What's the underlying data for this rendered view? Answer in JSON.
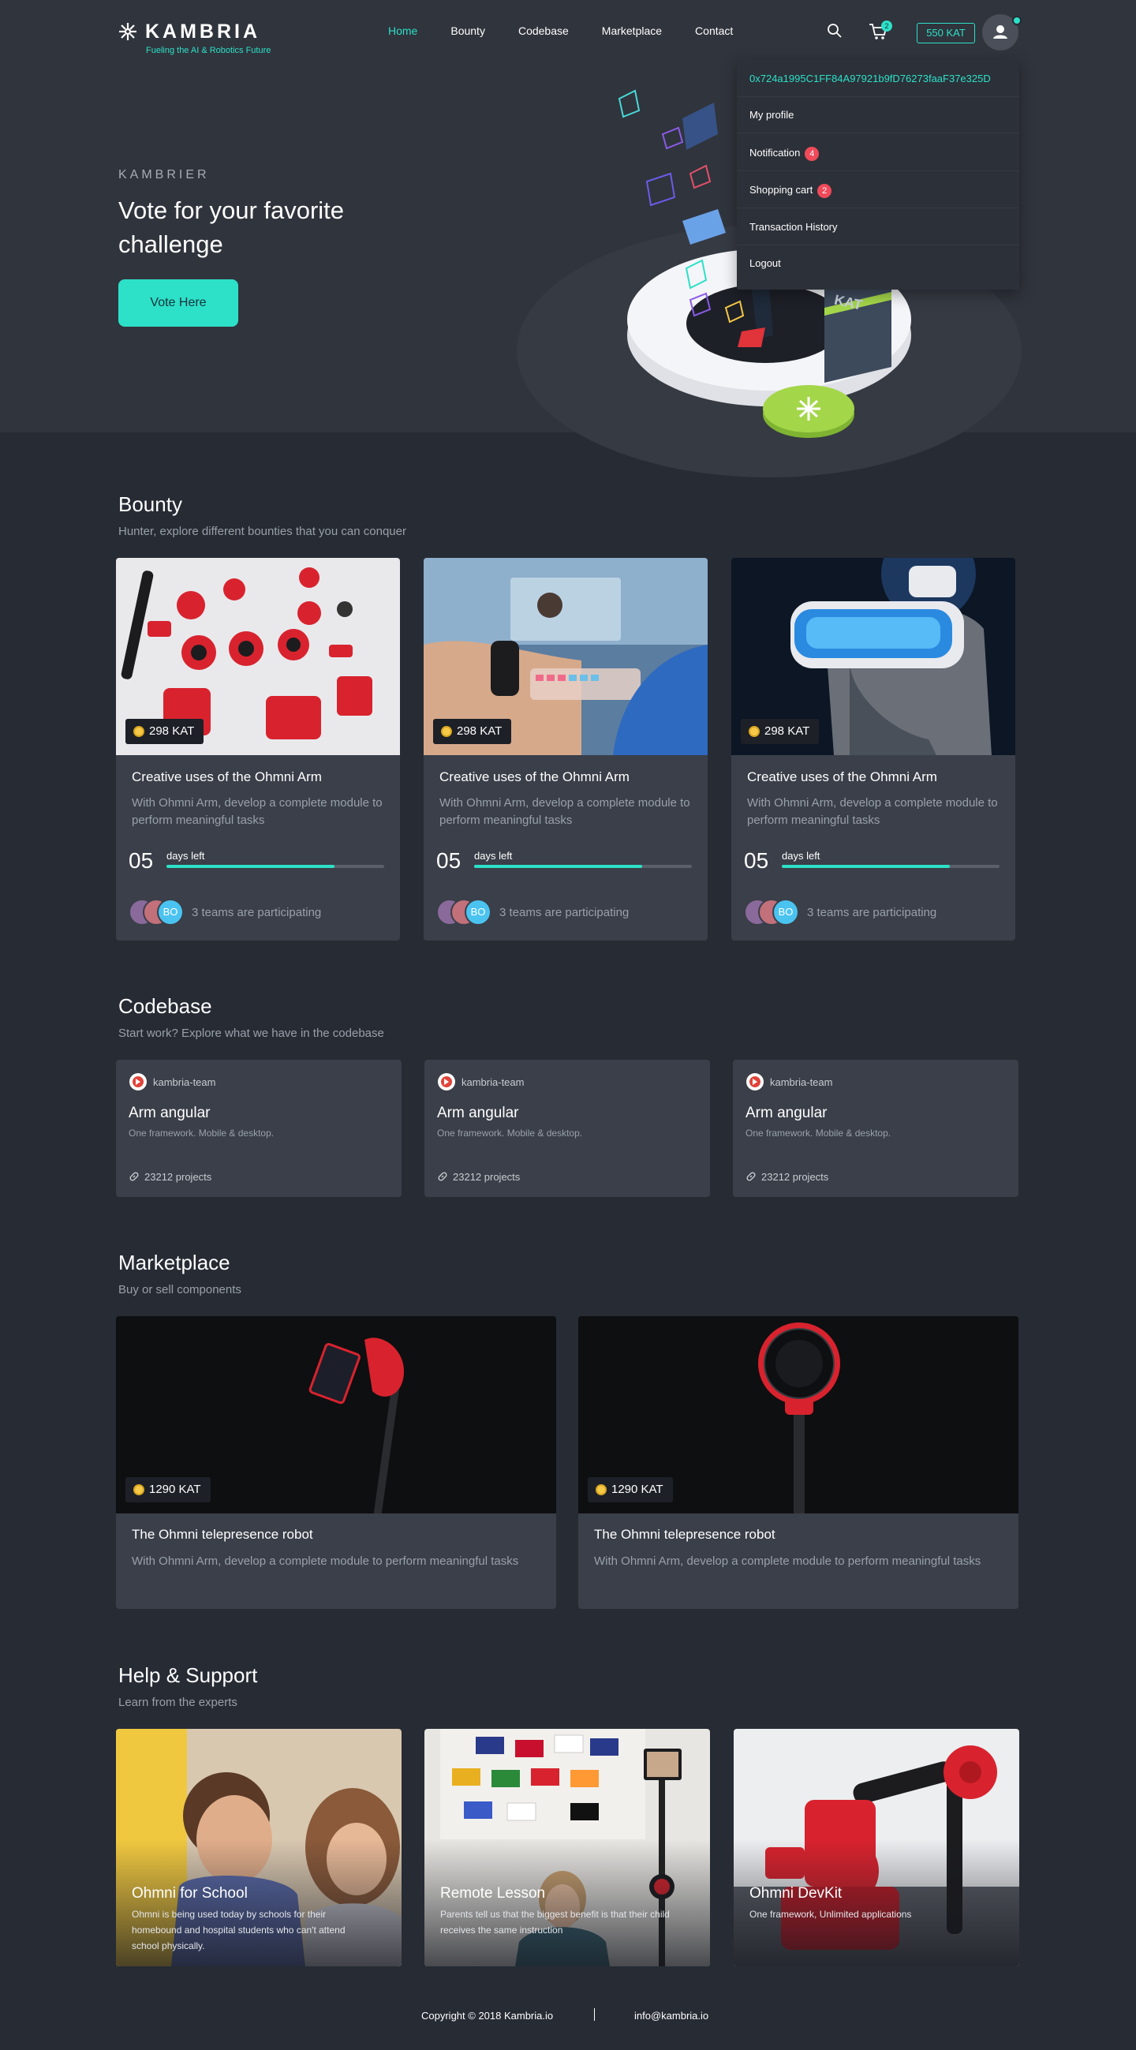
{
  "brand": {
    "name": "KAMBRIA",
    "tagline": "Fueling the AI & Robotics Future"
  },
  "nav": {
    "items": [
      {
        "label": "Home",
        "active": true
      },
      {
        "label": "Bounty",
        "active": false
      },
      {
        "label": "Codebase",
        "active": false
      },
      {
        "label": "Marketplace",
        "active": false
      },
      {
        "label": "Contact",
        "active": false
      }
    ]
  },
  "header": {
    "search_icon": "search-icon",
    "cart_icon": "cart-icon",
    "cart_count": "2",
    "balance": "550 KAT",
    "avatar_icon": "user-icon"
  },
  "hero": {
    "eyebrow": "KAMBRIER",
    "title": "Vote for your favorite challenge",
    "button": "Vote Here",
    "illustration_text": "KAT"
  },
  "dropdown": {
    "wallet": "0x724a1995C1FF84A97921b9fD76273faaF37e325D",
    "items": [
      {
        "label": "My profile",
        "badge": ""
      },
      {
        "label": "Notification",
        "badge": "4"
      },
      {
        "label": "Shopping cart",
        "badge": "2"
      },
      {
        "label": "Transaction History",
        "badge": ""
      },
      {
        "label": "Logout",
        "badge": ""
      }
    ]
  },
  "bounty": {
    "title": "Bounty",
    "subtitle": "Hunter, explore different bounties that you can conquer",
    "cards": [
      {
        "reward": "298 KAT",
        "title": "Creative uses of the Ohmni Arm",
        "desc": "With Ohmni Arm, develop a complete module to perform meaningful tasks",
        "days": "05",
        "days_label": "days left",
        "progress": 0.77,
        "avatar_initials": "BO",
        "teams": "3 teams are participating"
      },
      {
        "reward": "298 KAT",
        "title": "Creative uses of the Ohmni Arm",
        "desc": "With Ohmni Arm, develop a complete module to perform meaningful tasks",
        "days": "05",
        "days_label": "days left",
        "progress": 0.77,
        "avatar_initials": "BO",
        "teams": "3 teams are participating"
      },
      {
        "reward": "298 KAT",
        "title": "Creative uses of the Ohmni Arm",
        "desc": "With Ohmni Arm, develop a complete module to perform meaningful tasks",
        "days": "05",
        "days_label": "days left",
        "progress": 0.77,
        "avatar_initials": "BO",
        "teams": "3 teams are participating"
      }
    ]
  },
  "codebase": {
    "title": "Codebase",
    "subtitle": "Start work? Explore what we have in the codebase",
    "cards": [
      {
        "team": "kambria-team",
        "title": "Arm angular",
        "desc": "One framework. Mobile & desktop.",
        "projects": "23212 projects"
      },
      {
        "team": "kambria-team",
        "title": "Arm angular",
        "desc": "One framework. Mobile & desktop.",
        "projects": "23212 projects"
      },
      {
        "team": "kambria-team",
        "title": "Arm angular",
        "desc": "One framework. Mobile & desktop.",
        "projects": "23212 projects"
      }
    ]
  },
  "marketplace": {
    "title": "Marketplace",
    "subtitle": "Buy or sell components",
    "cards": [
      {
        "price": "1290 KAT",
        "title": "The Ohmni telepresence robot",
        "desc": "With Ohmni Arm, develop a complete module to perform meaningful tasks"
      },
      {
        "price": "1290 KAT",
        "title": "The Ohmni telepresence robot",
        "desc": "With Ohmni Arm, develop a complete module to perform meaningful tasks"
      }
    ]
  },
  "help": {
    "title": "Help & Support",
    "subtitle": "Learn from the experts",
    "cards": [
      {
        "title": "Ohmni for School",
        "desc": "Ohmni is being used today by schools for their homebound and hospital students who can't attend school physically."
      },
      {
        "title": "Remote Lesson",
        "desc": "Parents tell us that the biggest benefit is that their child receives the same instruction"
      },
      {
        "title": "Ohmni DevKit",
        "desc": "One framework, Unlimited applications"
      }
    ]
  },
  "footer": {
    "copyright": "Copyright © 2018 Kambria.io",
    "email": "info@kambria.io"
  },
  "colors": {
    "accent": "#2de0c8",
    "background": "#262b34",
    "card": "#3a3f49",
    "hero": "#30343c",
    "badge": "#f04a5a",
    "coin": "#f7c948"
  }
}
